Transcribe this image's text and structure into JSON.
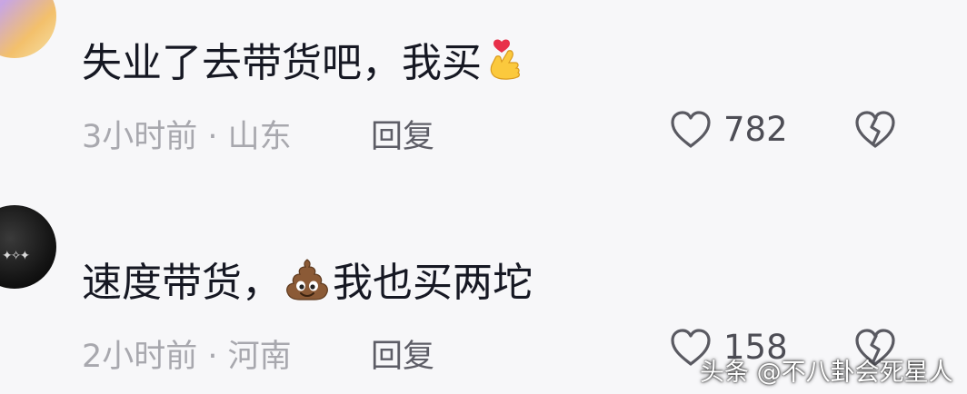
{
  "comments": [
    {
      "text_before": "失业了去带货吧，我买",
      "text_after": "",
      "emoji": "heart-hands-icon",
      "time": "3小时前 · 山东",
      "reply": "回复",
      "likes": "782"
    },
    {
      "text_before": "速度带货，",
      "text_after": "我也买两坨",
      "emoji": "poop-icon",
      "time": "2小时前 · 河南",
      "reply": "回复",
      "likes": "158"
    }
  ],
  "watermark": "头条 @不八卦会死星人",
  "colors": {
    "background": "#f7f7f9",
    "text": "#161823",
    "meta": "#a8a8ae",
    "reply": "#5d5d66",
    "icon": "#5a5a62"
  }
}
